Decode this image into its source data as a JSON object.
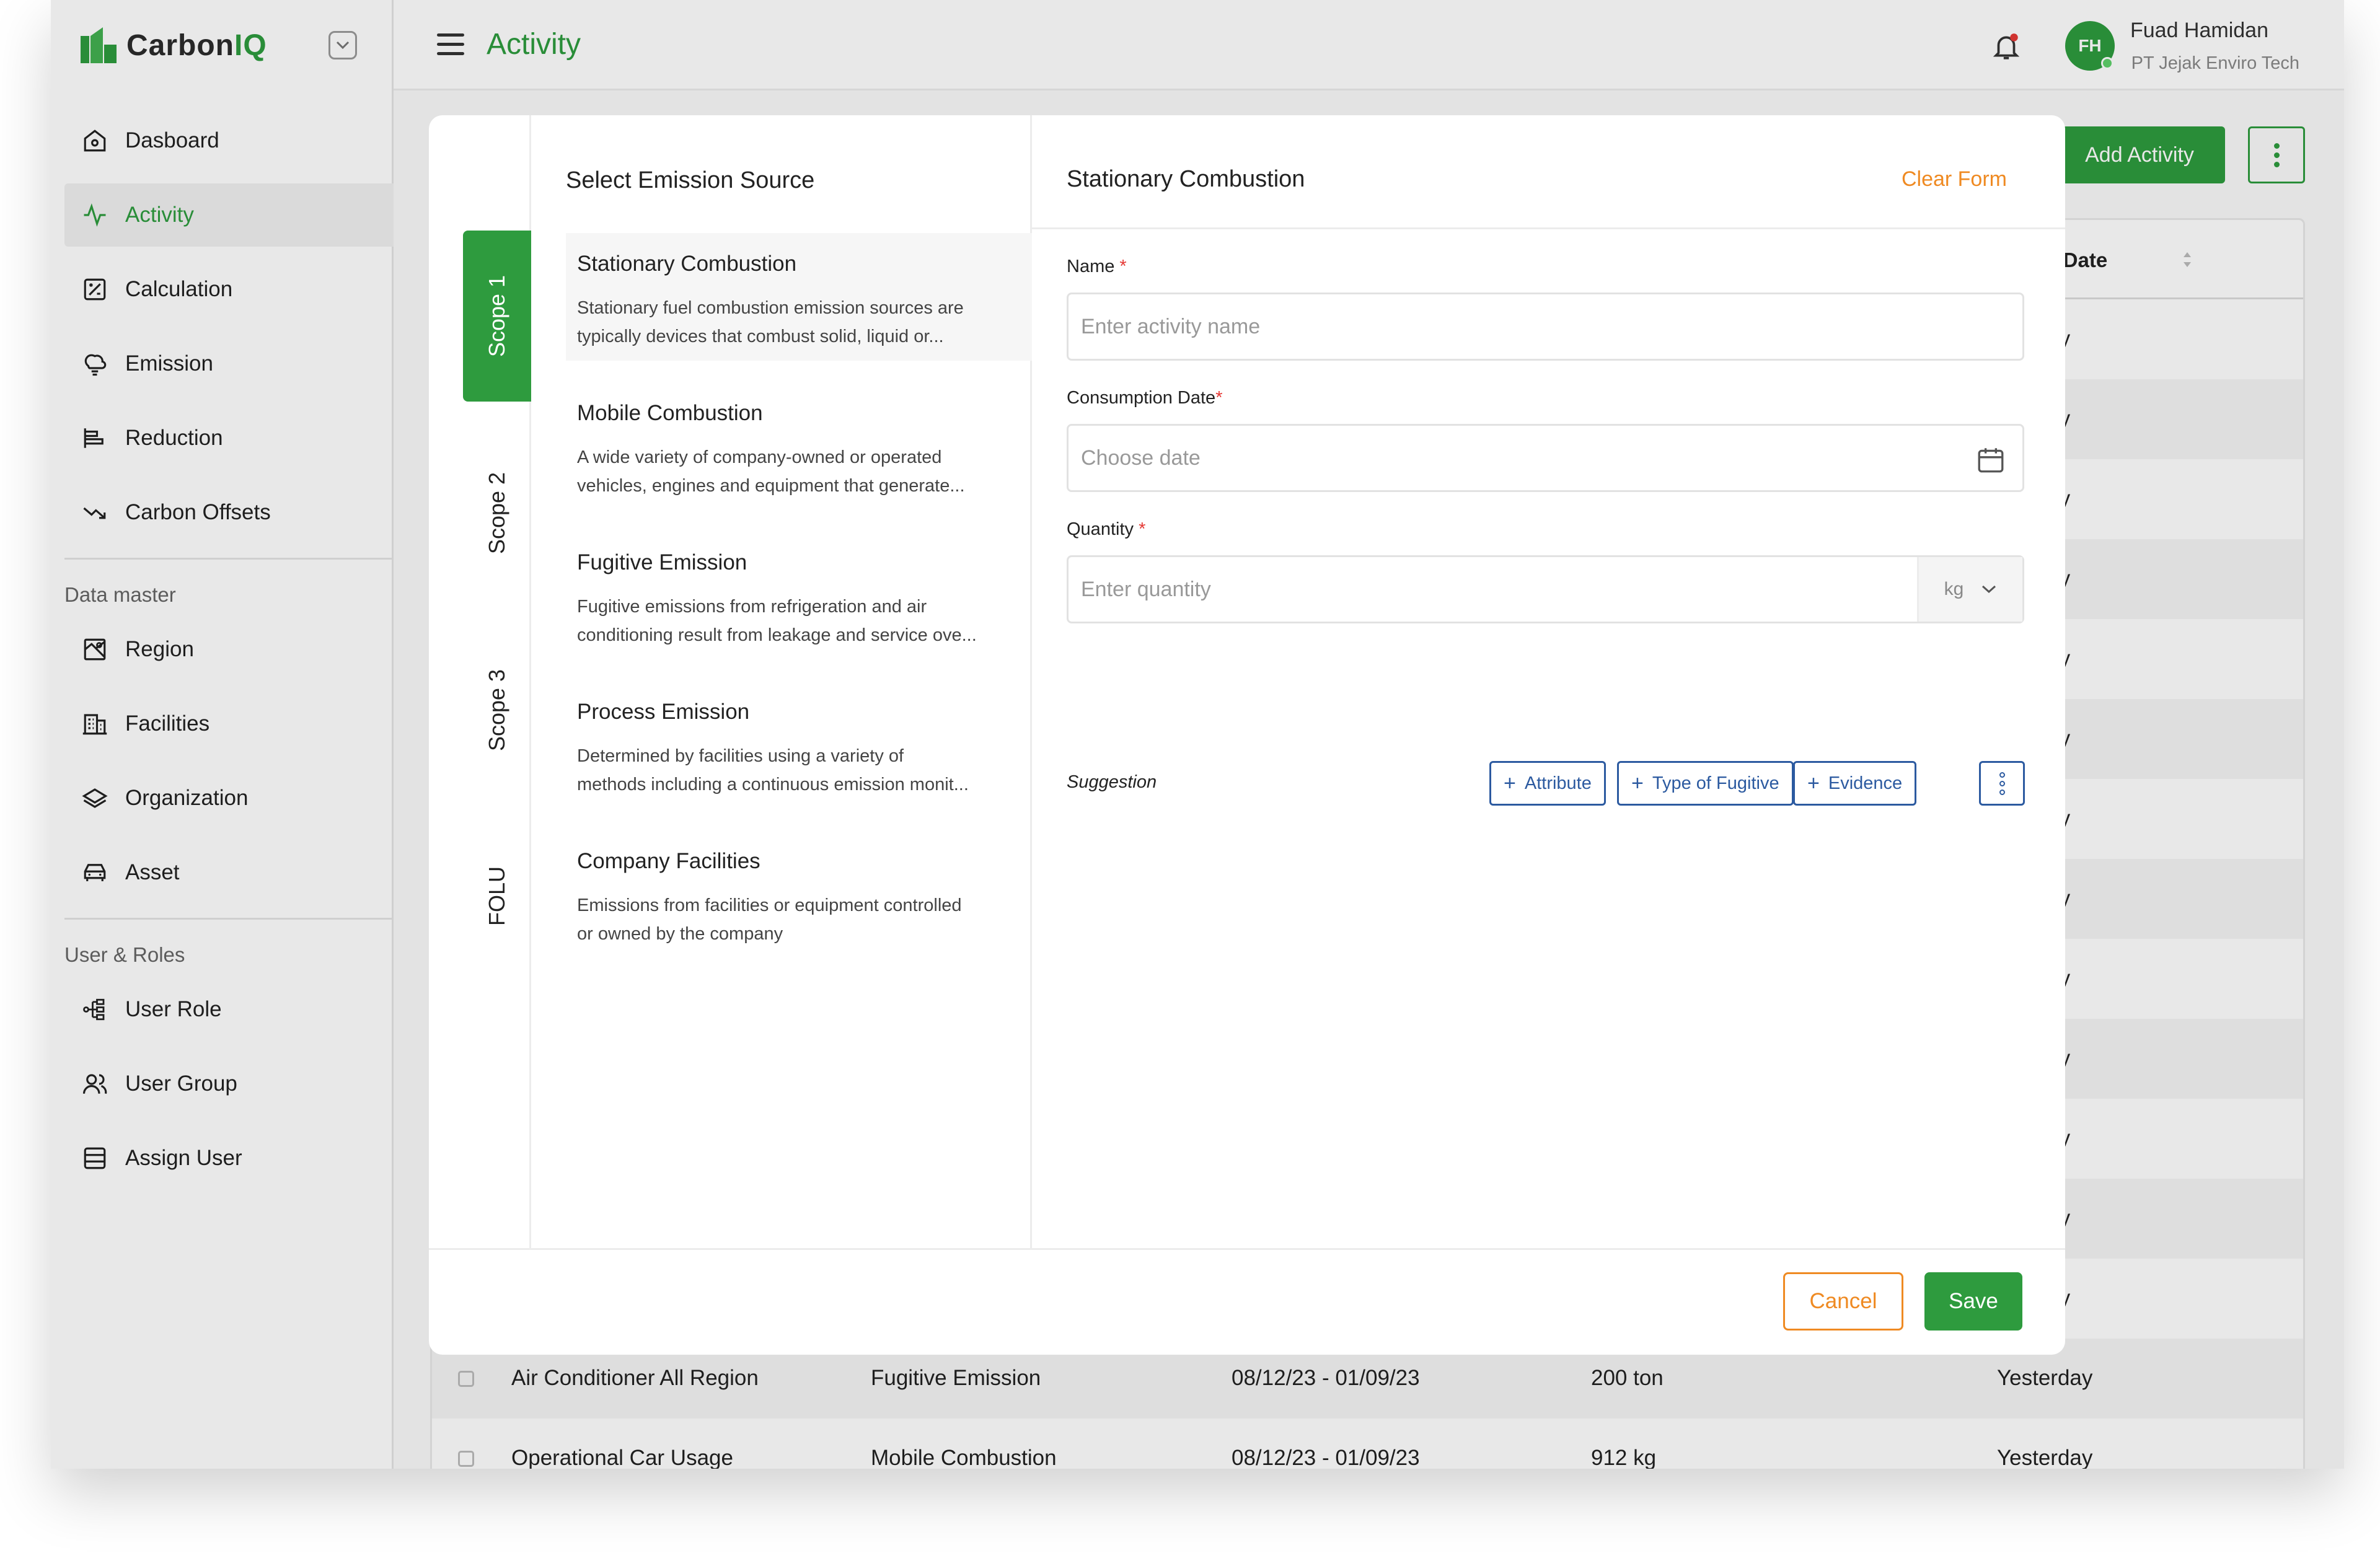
{
  "app": {
    "logo": {
      "part1": "Carbon",
      "part2": "IQ"
    },
    "page_title": "Activity"
  },
  "sidebar": {
    "main_items": [
      {
        "label": "Dasboard",
        "icon": "home-icon"
      },
      {
        "label": "Activity",
        "icon": "activity-icon",
        "active": true
      },
      {
        "label": "Calculation",
        "icon": "calculator-icon"
      },
      {
        "label": "Emission",
        "icon": "cloud-icon"
      },
      {
        "label": "Reduction",
        "icon": "chart-bar-icon"
      },
      {
        "label": "Carbon Offsets",
        "icon": "trend-down-icon"
      }
    ],
    "data_master_label": "Data master",
    "data_master_items": [
      {
        "label": "Region",
        "icon": "map-icon"
      },
      {
        "label": "Facilities",
        "icon": "building-icon"
      },
      {
        "label": "Organization",
        "icon": "layers-icon"
      },
      {
        "label": "Asset",
        "icon": "car-icon"
      }
    ],
    "user_roles_label": "User & Roles",
    "user_roles_items": [
      {
        "label": "User Role",
        "icon": "hierarchy-icon"
      },
      {
        "label": "User Group",
        "icon": "users-icon"
      },
      {
        "label": "Assign User",
        "icon": "list-icon"
      }
    ]
  },
  "header": {
    "user_initials": "FH",
    "user_name": "Fuad Hamidan",
    "user_org": "PT Jejak Enviro Tech"
  },
  "toolbar": {
    "add_label": "Add Activity"
  },
  "table": {
    "date_header": "ted Date",
    "partial_cell": "rday",
    "rows": [
      {
        "name": "Air Conditioner All Region",
        "type": "Fugitive Emission",
        "period": "08/12/23 - 01/09/23",
        "qty": "200 ton",
        "updated": "Yesterday"
      },
      {
        "name": "Operational Car Usage",
        "type": "Mobile Combustion",
        "period": "08/12/23 - 01/09/23",
        "qty": "912 kg",
        "updated": "Yesterday"
      }
    ]
  },
  "modal": {
    "scopes": [
      "Scope 1",
      "Scope 2",
      "Scope 3",
      "FOLU"
    ],
    "source_title": "Select Emission Source",
    "sources": [
      {
        "name": "Stationary Combustion",
        "desc1": "Stationary fuel combustion emission sources are",
        "desc2": "typically devices that combust solid, liquid or..."
      },
      {
        "name": "Mobile Combustion",
        "desc1": "A wide variety of company-owned or operated",
        "desc2": "vehicles, engines and equipment that generate..."
      },
      {
        "name": "Fugitive Emission",
        "desc1": "Fugitive emissions from refrigeration and air",
        "desc2": "conditioning result from leakage and service ove..."
      },
      {
        "name": "Process Emission",
        "desc1": "Determined by facilities using a variety of",
        "desc2": "methods including a continuous emission monit..."
      },
      {
        "name": "Company Facilities",
        "desc1": "Emissions from facilities or equipment controlled",
        "desc2": "or owned by the company"
      }
    ],
    "form": {
      "title": "Stationary Combustion",
      "clear_label": "Clear Form",
      "name_label": "Name",
      "name_placeholder": "Enter activity name",
      "date_label": "Consumption Date",
      "date_placeholder": "Choose date",
      "qty_label": "Quantity",
      "qty_placeholder": "Enter quantity",
      "unit": "kg",
      "required_mark": "*",
      "suggestion_label": "Suggestion",
      "chips": [
        "Attribute",
        "Type of Fugitive",
        "Evidence"
      ]
    },
    "cancel_label": "Cancel",
    "save_label": "Save"
  },
  "colors": {
    "brand": "#2e9b3e",
    "accent": "#ef8a22",
    "link": "#2c5aa0"
  }
}
